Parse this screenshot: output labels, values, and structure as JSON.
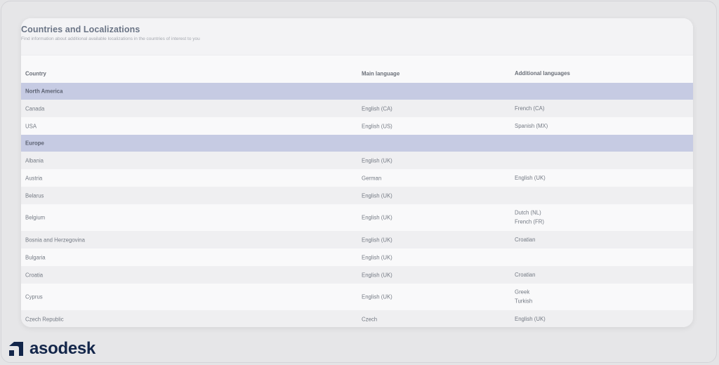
{
  "header": {
    "title": "Countries and Localizations",
    "subtitle": "Find information about additional available localizations in the countries of interest to you"
  },
  "table": {
    "columns": [
      "Country",
      "Main language",
      "Additional languages"
    ],
    "groups": [
      {
        "name": "North America",
        "rows": [
          {
            "country": "Canada",
            "main": "English (CA)",
            "additional": [
              "French (CA)"
            ]
          },
          {
            "country": "USA",
            "main": "English (US)",
            "additional": [
              "Spanish (MX)"
            ]
          }
        ]
      },
      {
        "name": "Europe",
        "rows": [
          {
            "country": "Albania",
            "main": "English (UK)",
            "additional": []
          },
          {
            "country": "Austria",
            "main": "German",
            "additional": [
              "English (UK)"
            ]
          },
          {
            "country": "Belarus",
            "main": "English (UK)",
            "additional": []
          },
          {
            "country": "Belgium",
            "main": "English (UK)",
            "additional": [
              "Dutch (NL)",
              "French (FR)"
            ]
          },
          {
            "country": "Bosnia and Herzegovina",
            "main": "English (UK)",
            "additional": [
              "Croatian"
            ]
          },
          {
            "country": "Bulgaria",
            "main": "English (UK)",
            "additional": []
          },
          {
            "country": "Croatia",
            "main": "English (UK)",
            "additional": [
              "Croatian"
            ]
          },
          {
            "country": "Cyprus",
            "main": "English (UK)",
            "additional": [
              "Greek",
              "Turkish"
            ]
          },
          {
            "country": "Czech Republic",
            "main": "Czech",
            "additional": [
              "English (UK)"
            ]
          }
        ]
      }
    ]
  },
  "brand": {
    "name": "asodesk",
    "icon": "asodesk-logo-icon",
    "color": "#13264a"
  }
}
